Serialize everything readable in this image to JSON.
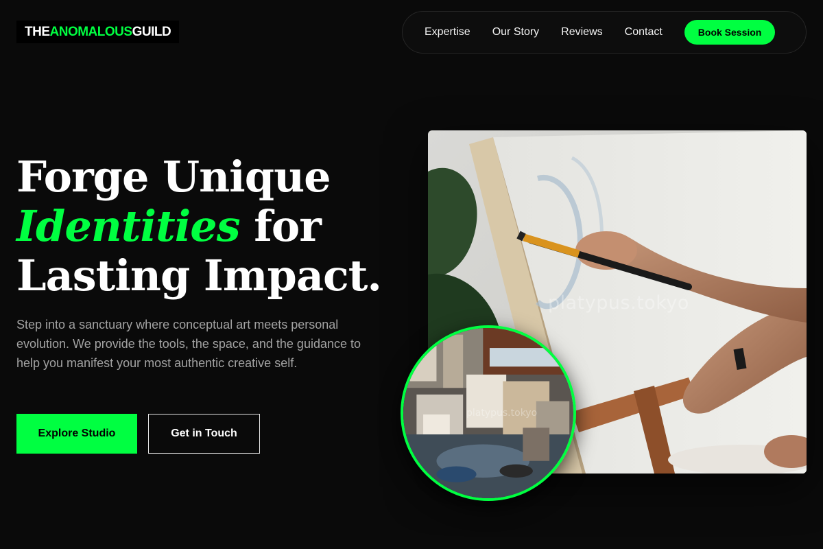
{
  "brand": {
    "name_part1": "THE ",
    "name_accent": "ANOMALOUS",
    "name_part2": " GUILD",
    "accent_color": "#00ff41"
  },
  "nav": {
    "links": [
      "Expertise",
      "Our Story",
      "Reviews",
      "Contact"
    ],
    "cta_label": "Book Session"
  },
  "hero": {
    "headline_line1": "Forge Unique",
    "headline_accent": "Identities",
    "headline_line2_rest": " for",
    "headline_line3": "Lasting Impact.",
    "description": "Step into a sanctuary where conceptual art meets personal evolution. We provide the tools, the space, and the guidance to help you manifest your most authentic creative self.",
    "primary_button": "Explore Studio",
    "secondary_button": "Get in Touch"
  },
  "images": {
    "main_watermark": "platypus.tokyo",
    "inset_watermark": "platypus.tokyo"
  },
  "colors": {
    "background": "#0a0a0a",
    "accent": "#00ff41",
    "text_muted": "#a3a3a3"
  }
}
